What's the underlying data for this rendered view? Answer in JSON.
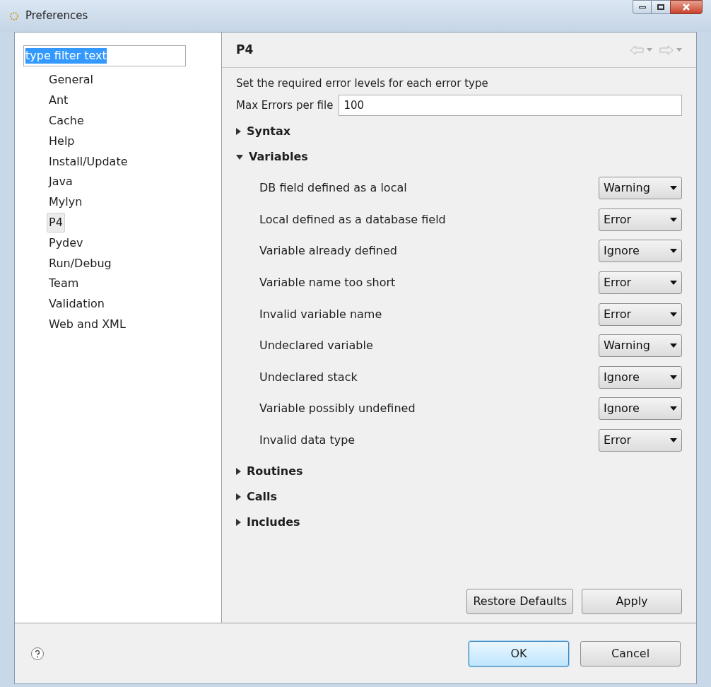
{
  "window": {
    "title": "Preferences"
  },
  "filter": {
    "value": "type filter text"
  },
  "sidebar": {
    "items": [
      {
        "label": "General",
        "selected": false
      },
      {
        "label": "Ant",
        "selected": false
      },
      {
        "label": "Cache",
        "selected": false
      },
      {
        "label": "Help",
        "selected": false
      },
      {
        "label": "Install/Update",
        "selected": false
      },
      {
        "label": "Java",
        "selected": false
      },
      {
        "label": "Mylyn",
        "selected": false
      },
      {
        "label": "P4",
        "selected": true
      },
      {
        "label": "Pydev",
        "selected": false
      },
      {
        "label": "Run/Debug",
        "selected": false
      },
      {
        "label": "Team",
        "selected": false
      },
      {
        "label": "Validation",
        "selected": false
      },
      {
        "label": "Web and XML",
        "selected": false
      }
    ]
  },
  "page": {
    "title": "P4",
    "description": "Set the required error levels for each error type",
    "max_errors": {
      "label": "Max Errors per file",
      "value": "100"
    },
    "sections": [
      {
        "label": "Syntax",
        "expanded": false
      },
      {
        "label": "Variables",
        "expanded": true,
        "rows": [
          {
            "label": "DB field defined as a local",
            "value": "Warning"
          },
          {
            "label": "Local defined as a database field",
            "value": "Error"
          },
          {
            "label": "Variable already defined",
            "value": "Ignore"
          },
          {
            "label": "Variable name too short",
            "value": "Error"
          },
          {
            "label": "Invalid variable name",
            "value": "Error"
          },
          {
            "label": "Undeclared variable",
            "value": "Warning"
          },
          {
            "label": "Undeclared stack",
            "value": "Ignore"
          },
          {
            "label": "Variable possibly undefined",
            "value": "Ignore"
          },
          {
            "label": "Invalid data type",
            "value": "Error"
          }
        ]
      },
      {
        "label": "Routines",
        "expanded": false
      },
      {
        "label": "Calls",
        "expanded": false
      },
      {
        "label": "Includes",
        "expanded": false
      }
    ],
    "buttons": [
      "Restore Defaults",
      "Apply"
    ]
  },
  "footer": {
    "buttons": [
      {
        "label": "OK",
        "selected": true
      },
      {
        "label": "Cancel",
        "selected": false
      }
    ]
  }
}
